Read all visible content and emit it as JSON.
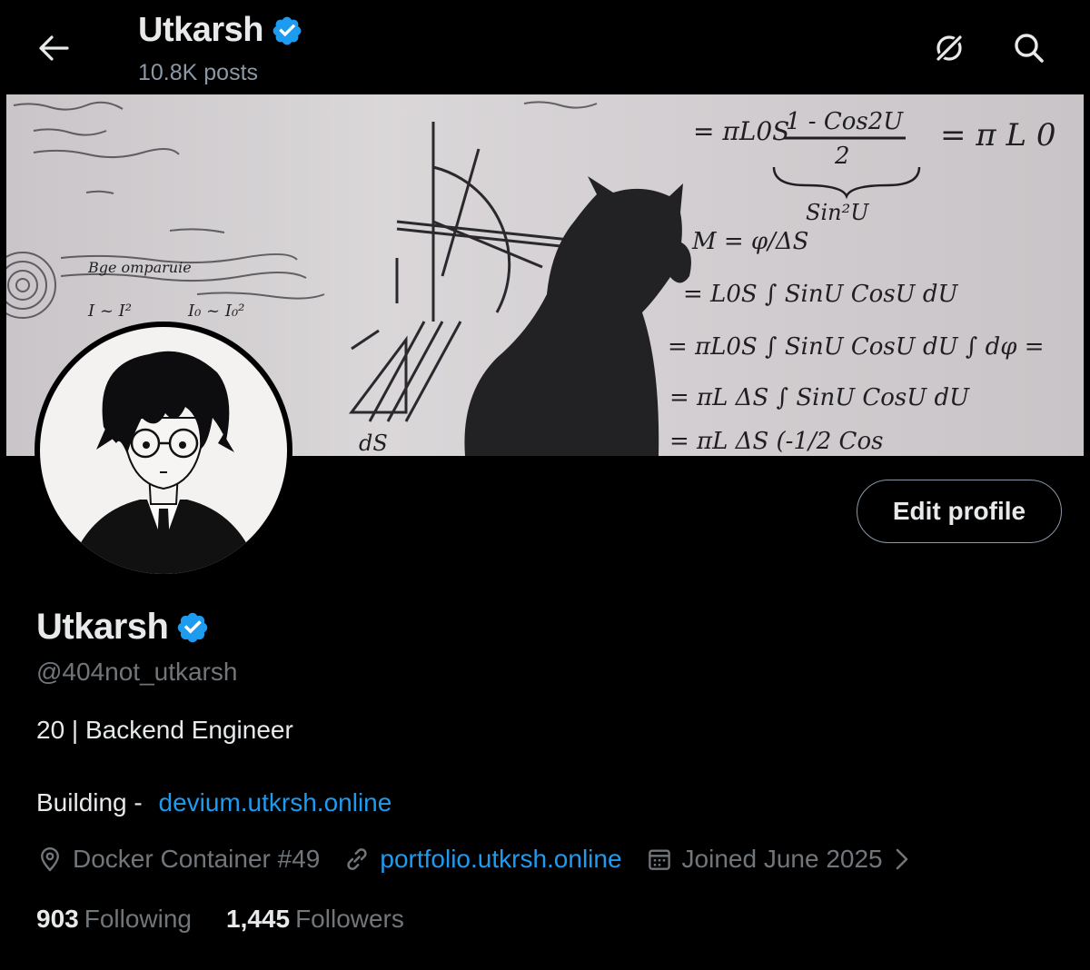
{
  "header": {
    "name": "Utkarsh",
    "posts_count": "10.8K posts"
  },
  "profile": {
    "display_name": "Utkarsh",
    "handle": "@404not_utkarsh",
    "bio_line": "20 | Backend Engineer",
    "building_label": "Building -",
    "building_link": "devium.utkrsh.online",
    "location": "Docker Container #49",
    "website": "portfolio.utkrsh.online",
    "joined": "Joined June 2025",
    "edit_button": "Edit profile"
  },
  "stats": {
    "following_count": "903",
    "following_label": "Following",
    "followers_count": "1,445",
    "followers_label": "Followers"
  },
  "banner": {
    "formulas": {
      "line1_left": "= πL0S",
      "line1_frac_top": "1 - Cos2U",
      "line1_frac_bot": "2",
      "line1_right": "= π L 0",
      "line1_under": "Sin²U",
      "line2": "M = φ/ΔS",
      "line3": "= L0S ∫ SinU CosU dU",
      "line4": "= πL0S ∫ SinU CosU dU ∫ dφ =",
      "line5": "= πL ΔS ∫ SinU CosU dU",
      "line6": "= πL ΔS (-1/2 Cos",
      "left1": "Bge omparuie",
      "left2": "I ~ I²",
      "left3": "I₀ ~ I₀²",
      "ds": "dS"
    }
  },
  "colors": {
    "background": "#000000",
    "text_primary": "#e7e9ea",
    "text_secondary": "#71767b",
    "link": "#1d9bf0",
    "verified": "#1d9bf0"
  },
  "icons": {
    "back": "arrow-left-icon",
    "grok": "grok-icon",
    "search": "search-icon",
    "verified": "verified-badge-icon",
    "location": "location-pin-icon",
    "link": "link-icon",
    "calendar": "calendar-icon",
    "chevron": "chevron-right-icon"
  }
}
